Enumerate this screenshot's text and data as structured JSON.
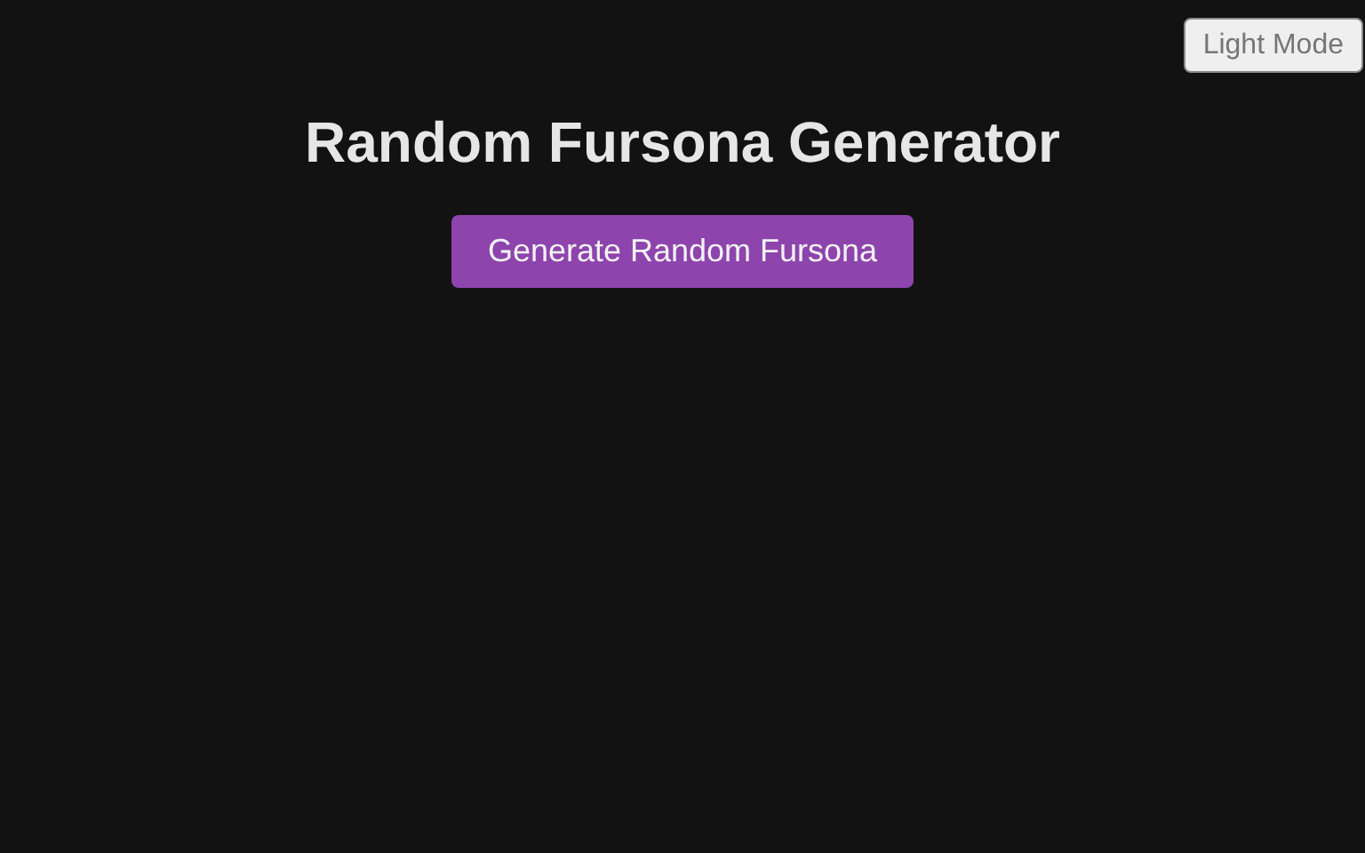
{
  "theme_toggle": {
    "label": "Light Mode"
  },
  "title": "Random Fursona Generator",
  "generate_button": {
    "label": "Generate Random Fursona"
  }
}
